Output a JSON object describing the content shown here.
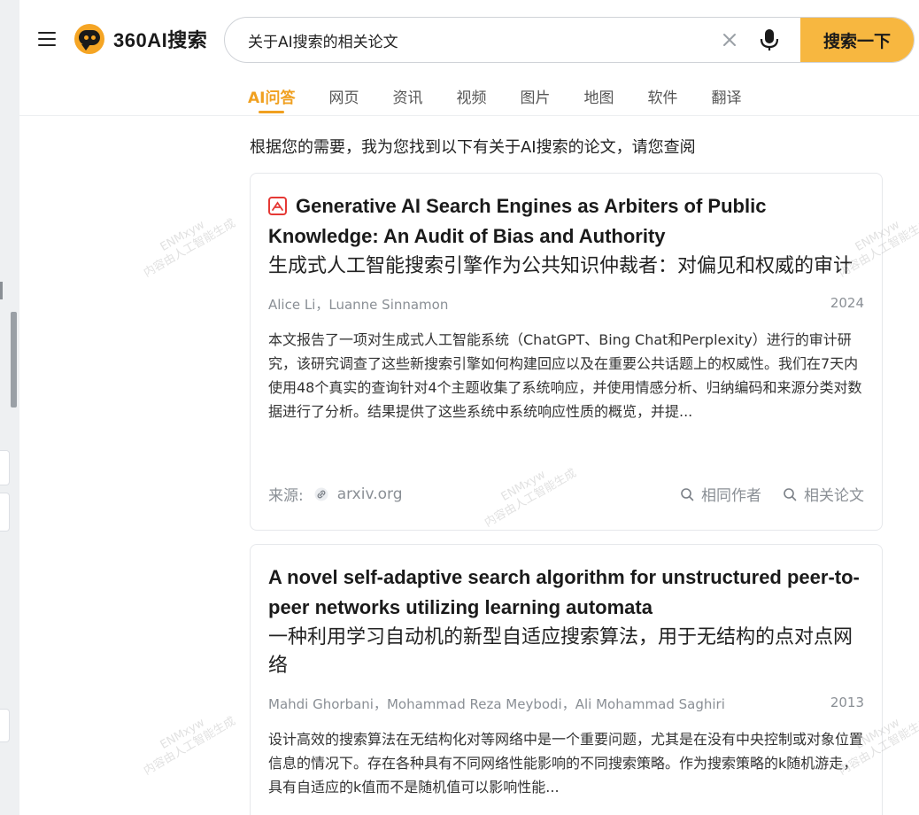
{
  "app": {
    "logo_text": "360AI搜索"
  },
  "search": {
    "value": "关于AI搜索的相关论文",
    "button_label": "搜索一下"
  },
  "tabs": [
    {
      "label": "AI问答",
      "active": true
    },
    {
      "label": "网页"
    },
    {
      "label": "资讯"
    },
    {
      "label": "视频"
    },
    {
      "label": "图片"
    },
    {
      "label": "地图"
    },
    {
      "label": "软件"
    },
    {
      "label": "翻译"
    }
  ],
  "intro": "根据您的需要，我为您找到以下有关于AI搜索的论文，请您查阅",
  "results": [
    {
      "title_en": "Generative AI Search Engines as Arbiters of Public Knowledge: An Audit of Bias and Authority",
      "title_zh": "生成式人工智能搜索引擎作为公共知识仲裁者：对偏见和权威的审计",
      "authors": "Alice Li，Luanne Sinnamon",
      "year": "2024",
      "abstract": "本文报告了一项对生成式人工智能系统（ChatGPT、Bing Chat和Perplexity）进行的审计研究，该研究调查了这些新搜索引擎如何构建回应以及在重要公共话题上的权威性。我们在7天内使用48个真实的查询针对4个主题收集了系统响应，并使用情感分析、归纳编码和来源分类对数据进行了分析。结果提供了这些系统中系统响应性质的概览，并提...",
      "source_label": "来源:",
      "source": "arxiv.org",
      "action_same_author": "相同作者",
      "action_related": "相关论文"
    },
    {
      "title_en": "A novel self-adaptive search algorithm for unstructured peer-to-peer networks utilizing learning automata",
      "title_zh": "一种利用学习自动机的新型自适应搜索算法，用于无结构的点对点网络",
      "authors": "Mahdi Ghorbani，Mohammad Reza Meybodi，Ali Mohammad Saghiri",
      "year": "2013",
      "abstract": "设计高效的搜索算法在无结构化对等网络中是一个重要问题，尤其是在没有中央控制或对象位置信息的情况下。存在各种具有不同网络性能影响的不同搜索策略。作为搜索策略的k随机游走，具有自适应的k值而不是随机值可以影响性能..."
    }
  ],
  "watermark": {
    "line1": "ENMxyw",
    "line2": "内容由人工智能生成"
  },
  "colors": {
    "accent": "#f7b740",
    "active_tab": "#f0a020",
    "pdf_red": "#e53935"
  }
}
